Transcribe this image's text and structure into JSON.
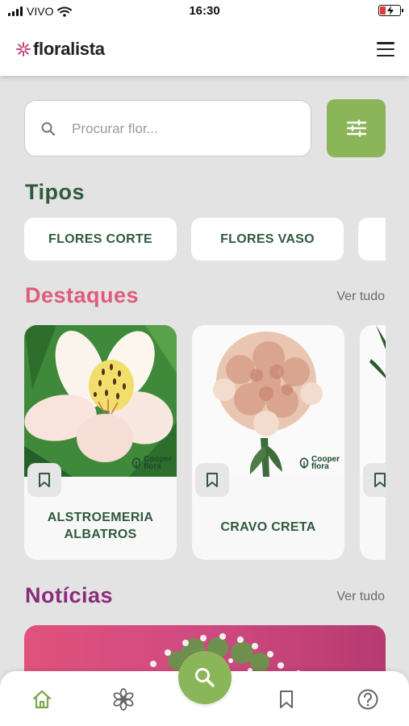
{
  "status_bar": {
    "carrier": "VIVO",
    "time": "16:30"
  },
  "header": {
    "logo_text": "floralista"
  },
  "search": {
    "placeholder": "Procurar flor..."
  },
  "sections": {
    "tipos": {
      "title": "Tipos",
      "chips": [
        "FLORES CORTE",
        "FLORES VASO"
      ]
    },
    "destaques": {
      "title": "Destaques",
      "see_all": "Ver tudo",
      "items": [
        {
          "name": "ALSTROEMERIA ALBATROS",
          "brand": [
            "Cooper",
            "flora"
          ]
        },
        {
          "name": "CRAVO CRETA",
          "brand": [
            "Cooper",
            "flora"
          ]
        }
      ]
    },
    "noticias": {
      "title": "Notícias",
      "see_all": "Ver tudo"
    }
  },
  "colors": {
    "green": "#8ab558",
    "dark_green": "#2f5a3d",
    "pink": "#e05a7a",
    "purple": "#8b2a7a",
    "background": "#e3e3e3"
  },
  "icons": {
    "logo": "flower-asterisk-icon",
    "menu": "hamburger-menu-icon",
    "search": "search-icon",
    "filter": "sliders-icon",
    "bookmark": "bookmark-icon",
    "nav": [
      "home-icon",
      "flower-icon",
      "search-icon",
      "bookmark-icon",
      "help-icon"
    ]
  }
}
